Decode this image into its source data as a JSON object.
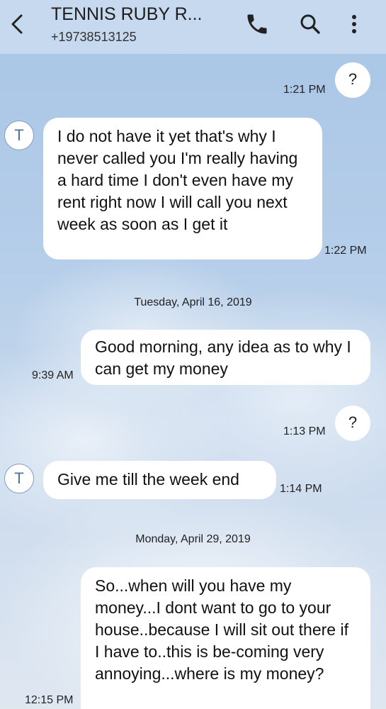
{
  "header": {
    "title": "TENNIS RUBY R...",
    "phone": "+19738513125",
    "icons": [
      "back-arrow-icon",
      "phone-icon",
      "search-icon",
      "more-vert-icon"
    ]
  },
  "avatar_letter": "T",
  "messages": [
    {
      "side": "sent",
      "text": "?",
      "time": "1:21 PM"
    },
    {
      "side": "received",
      "text": "I do not have it yet that's why I never called you I'm really having a hard time I don't even have my rent right now I will call you next week as soon as I get it",
      "time": "1:22 PM"
    },
    {
      "date": "Tuesday, April 16, 2019"
    },
    {
      "side": "sent",
      "text": "Good morning, any idea as to why I can get my money",
      "time": "9:39 AM"
    },
    {
      "side": "sent",
      "text": "?",
      "time": "1:13 PM"
    },
    {
      "side": "received",
      "text": "Give me till the week end",
      "time": "1:14 PM"
    },
    {
      "date": "Monday, April 29, 2019"
    },
    {
      "side": "sent",
      "text": "So...when will you have my money...I dont want to go to your house..because I will sit out there if I have to..this is be-coming very annoying...where is my money?",
      "time": "12:15 PM"
    }
  ],
  "colors": {
    "header_bg": "#c6d9ef",
    "bubble_bg": "#ffffff",
    "avatar_text": "#4e7399"
  }
}
